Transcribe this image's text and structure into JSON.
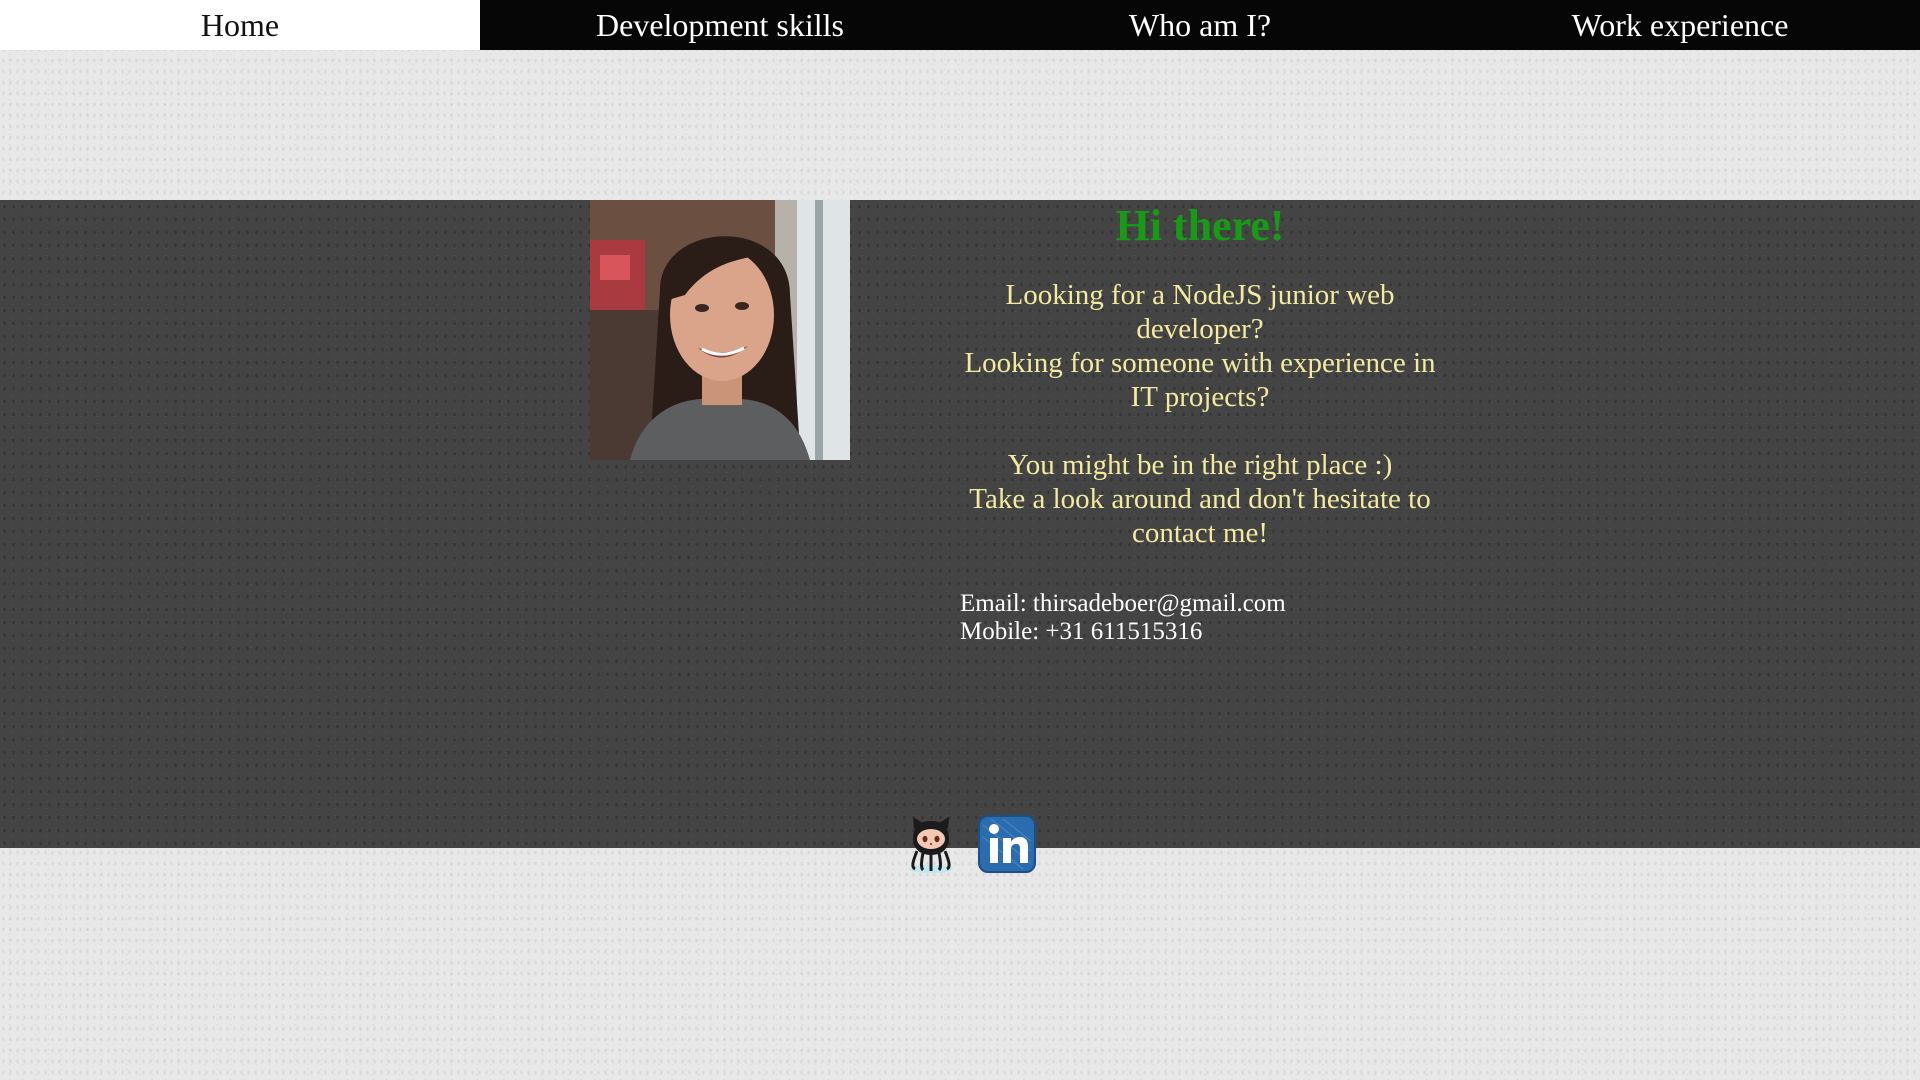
{
  "nav": {
    "items": [
      {
        "label": "Home",
        "active": true
      },
      {
        "label": "Development skills",
        "active": false
      },
      {
        "label": "Who am I?",
        "active": false
      },
      {
        "label": "Work experience",
        "active": false
      }
    ]
  },
  "profile": {
    "photo_icon": "profile-photo"
  },
  "intro": {
    "greeting": "Hi there!",
    "lines_block_1": [
      "Looking for a NodeJS junior web developer?",
      "Looking for someone with experience in IT projects?"
    ],
    "lines_block_2": [
      "You might be in the right place :)",
      "Take a look around and don't hesitate to contact me!"
    ]
  },
  "contact": {
    "email_line": "Email: thirsadeboer@gmail.com",
    "mobile_line": "Mobile: +31 611515316"
  },
  "social": {
    "github_icon": "github-octocat-icon",
    "linkedin_icon": "linkedin-icon"
  },
  "colors": {
    "greeting": "#199a16",
    "pitch_text": "#f3eaa0",
    "band": "#444444",
    "nav_bg": "#060606",
    "nav_active_bg": "#ffffff"
  }
}
